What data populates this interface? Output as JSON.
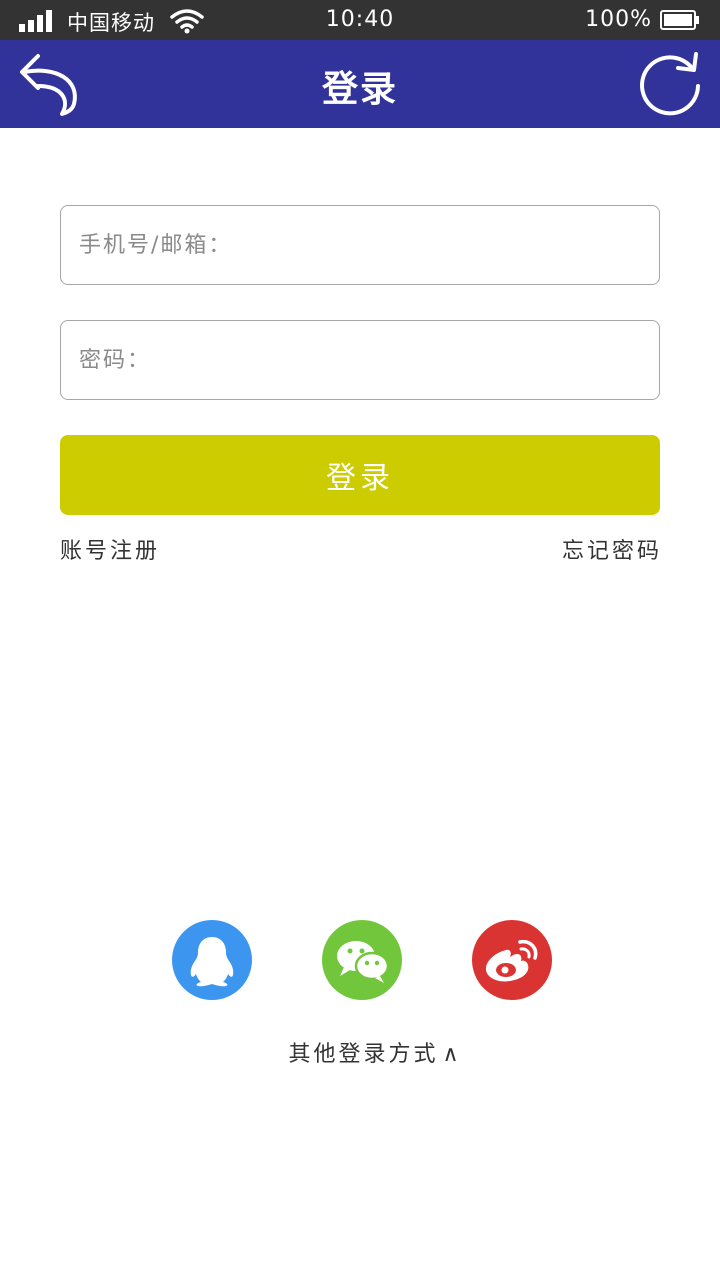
{
  "status_bar": {
    "carrier": "中国移动",
    "time": "10:40",
    "battery": "100%"
  },
  "header": {
    "title": "登录",
    "back_icon": "back-arrow-icon",
    "refresh_icon": "refresh-icon",
    "background": "#31339a"
  },
  "form": {
    "phone_placeholder": "手机号/邮箱：",
    "phone_value": "",
    "password_placeholder": "密码：",
    "password_value": "",
    "login_label": "登录",
    "login_color": "#cccc00",
    "register_label": "账号注册",
    "forgot_label": "忘记密码"
  },
  "social": {
    "items": [
      {
        "name": "QQ",
        "icon": "qq-icon",
        "color": "#3c96f0"
      },
      {
        "name": "WeChat",
        "icon": "wechat-icon",
        "color": "#72c63c"
      },
      {
        "name": "Weibo",
        "icon": "weibo-icon",
        "color": "#d93432"
      }
    ],
    "other_label": "其他登录方式",
    "caret": "∧"
  }
}
